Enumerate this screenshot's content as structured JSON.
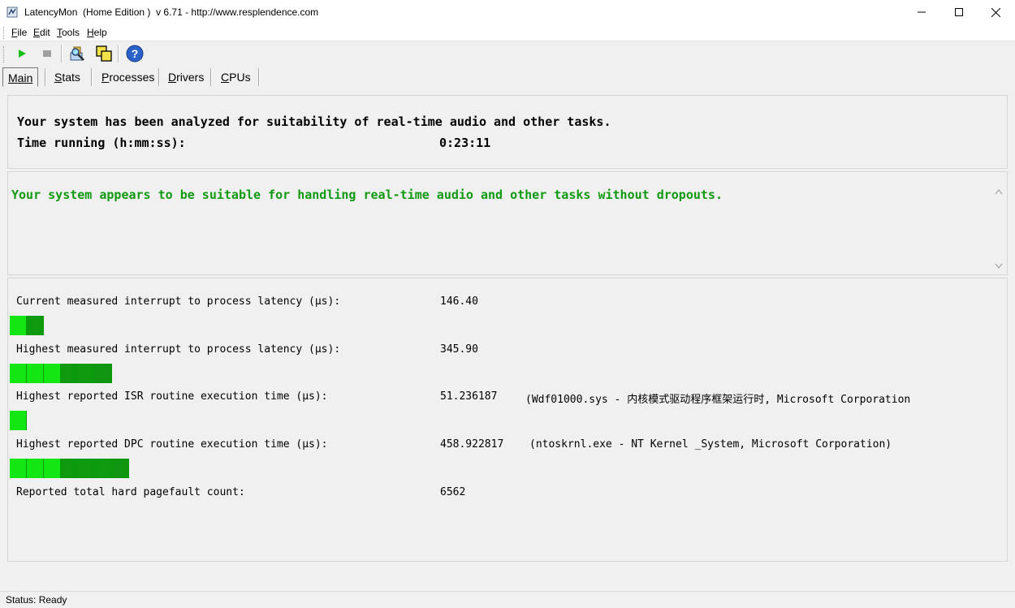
{
  "window": {
    "title": "LatencyMon  (Home Edition )  v 6.71 - http://www.resplendence.com",
    "minimize_glyph": "—",
    "maximize_glyph": "☐",
    "close_glyph": "✕"
  },
  "menu": {
    "items": [
      {
        "label": "File",
        "mnemonic": "F",
        "rest": "ile"
      },
      {
        "label": "Edit",
        "mnemonic": "E",
        "rest": "dit"
      },
      {
        "label": "Tools",
        "mnemonic": "T",
        "rest": "ools"
      },
      {
        "label": "Help",
        "mnemonic": "H",
        "rest": "elp"
      }
    ]
  },
  "toolbar": {
    "buttons": [
      "start-icon",
      "stop-icon",
      "analyze-icon",
      "copy-windows-icon",
      "help-icon"
    ]
  },
  "tabs": [
    {
      "label": "Main",
      "mnemonic": "M",
      "rest": "ain",
      "active": true
    },
    {
      "label": "Stats",
      "mnemonic": "S",
      "rest": "tats",
      "active": false
    },
    {
      "label": "Processes",
      "mnemonic": "P",
      "rest": "rocesses",
      "active": false
    },
    {
      "label": "Drivers",
      "mnemonic": "D",
      "rest": "rivers",
      "active": false
    },
    {
      "label": "CPUs",
      "mnemonic": "C",
      "rest": "PUs",
      "active": false
    }
  ],
  "summary": {
    "analyzed_text": "Your system has been analyzed for suitability of real-time audio and other tasks.",
    "time_label": "Time running (h:mm:ss):",
    "time_value": "0:23:11"
  },
  "verdict": {
    "text": "Your system appears to be suitable for handling real-time audio and other tasks without dropouts.",
    "color": "#119911"
  },
  "metrics": [
    {
      "label": "Current measured interrupt to process latency (µs):",
      "value": "146.40",
      "detail": "",
      "meter_segments": 2
    },
    {
      "label": "Highest measured interrupt to process latency (µs):",
      "value": "345.90",
      "detail": "",
      "meter_segments": 6
    },
    {
      "label": "Highest reported ISR routine execution time (µs):",
      "value": "51.236187",
      "detail": "(Wdf01000.sys - 内核模式驱动程序框架运行时, Microsoft Corporation",
      "meter_segments": 1
    },
    {
      "label": "Highest reported DPC routine execution time (µs):",
      "value": "458.922817",
      "detail": "(ntoskrnl.exe - NT Kernel _System, Microsoft Corporation)",
      "meter_segments": 7
    },
    {
      "label": "Reported total hard pagefault count:",
      "value": "6562",
      "detail": "",
      "meter_segments": 0
    }
  ],
  "status": {
    "text": "Status: Ready"
  },
  "colors": {
    "meter_light": "#14e614",
    "meter_dark": "#0e9a0e"
  }
}
